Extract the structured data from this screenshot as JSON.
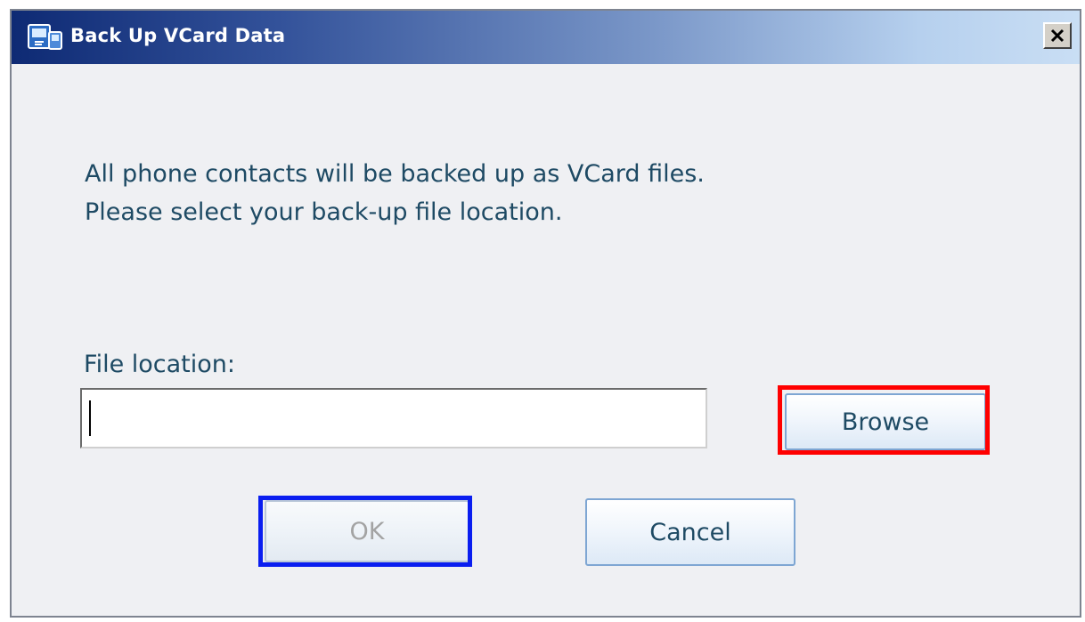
{
  "window": {
    "title": "Back Up VCard Data",
    "app_icon": "phone-sync-icon",
    "close_label": "X",
    "close_icon": "close-icon"
  },
  "message": {
    "line1": "All phone contacts will be backed up as VCard files.",
    "line2": "Please select your back-up file location."
  },
  "file_location": {
    "label": "File location:",
    "value": "",
    "placeholder": ""
  },
  "buttons": {
    "browse": "Browse",
    "ok": "OK",
    "cancel": "Cancel"
  },
  "colors": {
    "text": "#1e4a64",
    "disabled_text": "#a3a3a3",
    "dialog_bg": "#eff0f3",
    "browse_highlight": "#ff0000",
    "ok_highlight": "#0a1ef0"
  }
}
